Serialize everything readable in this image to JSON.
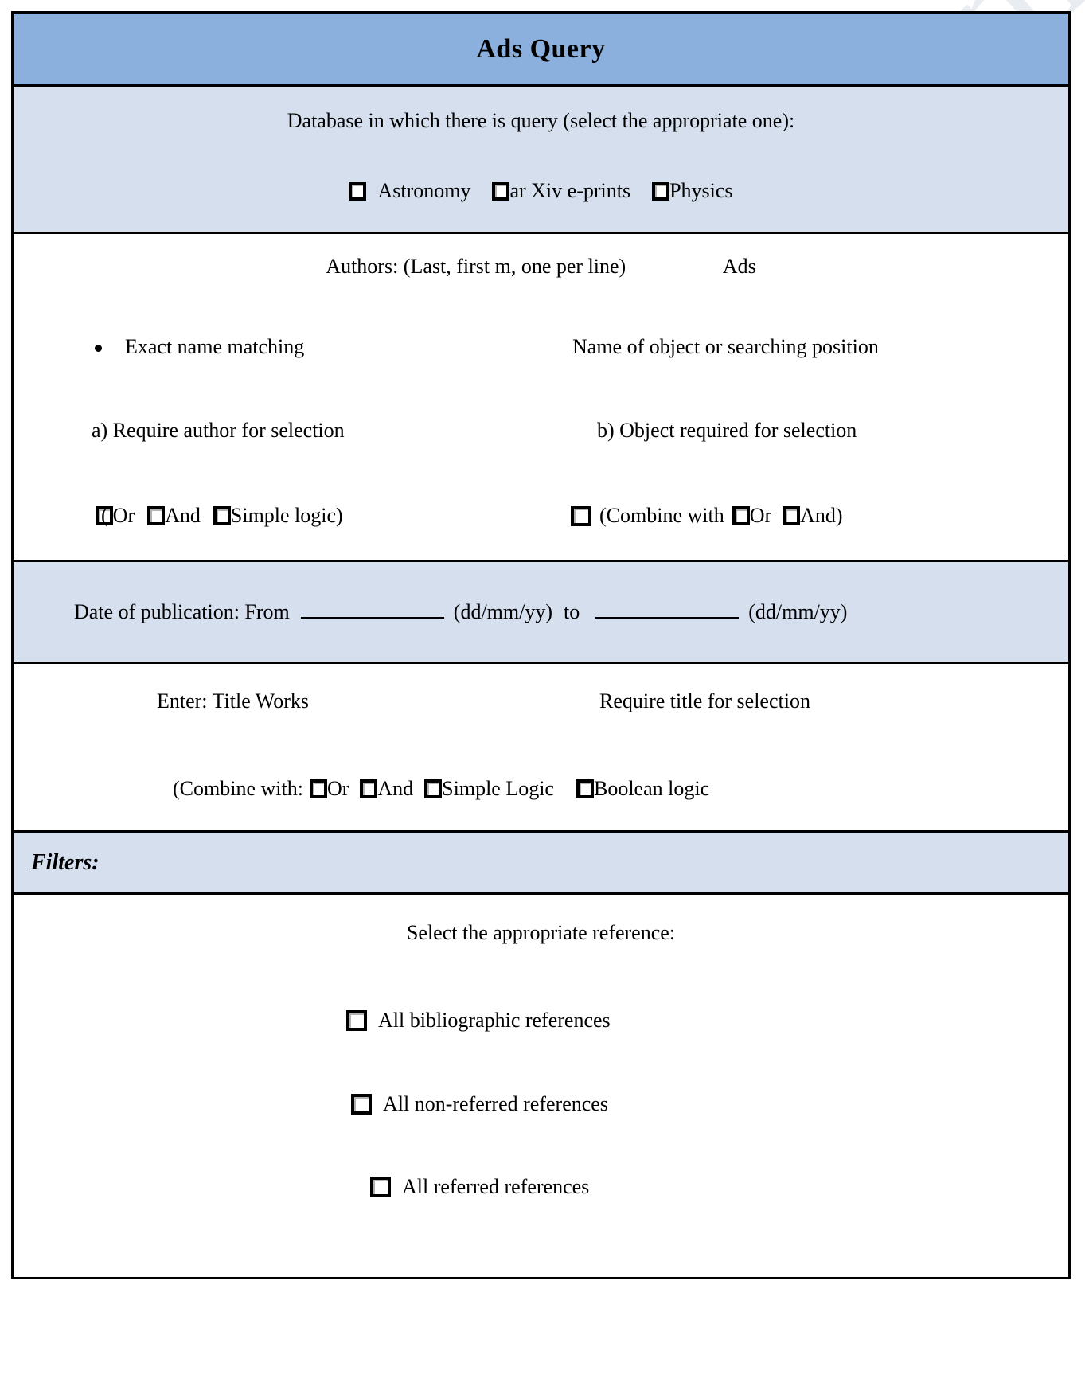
{
  "watermark": {
    "text": "editableforms.com"
  },
  "header": {
    "title": "Ads Query"
  },
  "database": {
    "prompt": "Database in which there is query (select the appropriate one):",
    "options": [
      {
        "label": "Astronomy"
      },
      {
        "label": "ar Xiv e-prints"
      },
      {
        "label": "Physics"
      }
    ]
  },
  "authors": {
    "heading_left": "Authors:  (Last, first m, one per line)",
    "heading_right": "Ads",
    "exact_name_matching": "Exact name matching",
    "object_name": "Name of object or searching position",
    "require_author": "a)   Require author for selection",
    "object_required": "b) Object required for selection",
    "author_logic": {
      "paren_open": "(",
      "options": [
        {
          "label": "Or"
        },
        {
          "label": "And"
        },
        {
          "label": "Simple logic)"
        }
      ]
    },
    "object_logic": {
      "combine_text": "(Combine with",
      "options": [
        {
          "label": "Or"
        },
        {
          "label": "And)"
        }
      ]
    }
  },
  "date": {
    "label": "Date of publication: From",
    "from_value": "",
    "from_format": "(dd/mm/yy)",
    "to_word": "to",
    "to_value": "",
    "to_format": "(dd/mm/yy)"
  },
  "title_works": {
    "enter_label": "Enter:  Title Works",
    "require_label": "Require title for selection",
    "combine_label": "(Combine with:",
    "options": [
      {
        "label": "Or"
      },
      {
        "label": "And"
      },
      {
        "label": "Simple Logic"
      },
      {
        "label": "Boolean logic"
      }
    ]
  },
  "filters": {
    "label": "Filters:",
    "reference_prompt": "Select the appropriate reference:",
    "references": [
      {
        "label": "All bibliographic references"
      },
      {
        "label": "All non-referred references"
      },
      {
        "label": "All referred references"
      }
    ]
  },
  "colors": {
    "title_band": "#8cb0dd",
    "light_band": "#d5dfee",
    "border": "#000000",
    "watermark": "#e9edf2"
  }
}
